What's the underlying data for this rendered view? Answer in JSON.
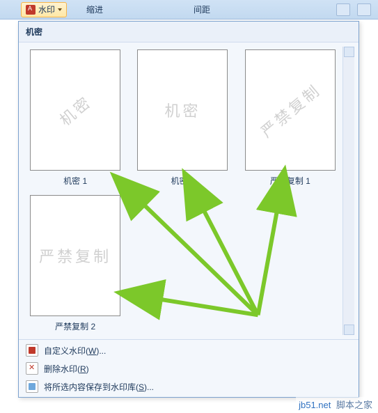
{
  "ribbon": {
    "watermark_btn": "水印",
    "group_indent": "缩进",
    "group_spacing": "间距"
  },
  "gallery": {
    "header": "机密",
    "thumbs": [
      {
        "watermark_text": "机密",
        "style": "diag",
        "label": "机密 1"
      },
      {
        "watermark_text": "机密",
        "style": "flat",
        "label": "机密 2"
      },
      {
        "watermark_text": "严禁复制",
        "style": "diag",
        "label": "严禁复制 1"
      },
      {
        "watermark_text": "严禁复制",
        "style": "flat",
        "label": "严禁复制 2"
      }
    ]
  },
  "menu": {
    "custom": {
      "pre": "自定义水印(",
      "key": "W",
      "post": ")..."
    },
    "remove": {
      "pre": "删除水印(",
      "key": "R",
      "post": ")"
    },
    "save": {
      "pre": "将所选内容保存到水印库(",
      "key": "S",
      "post": ")..."
    }
  },
  "site": {
    "url": "jb51.net",
    "name": "脚本之家"
  }
}
